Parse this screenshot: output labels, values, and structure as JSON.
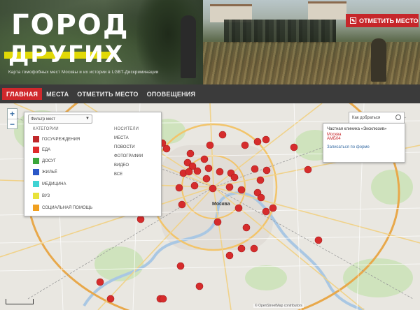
{
  "header": {
    "logo_line1": "ГОРОД",
    "logo_line2": "ДРУГИХ",
    "tagline": "Карта гомофобных мест Москвы и их истории в LGBT-Дискриминации",
    "report_button": "ОТМЕТИТЬ МЕСТО",
    "report_icon": "edit-icon"
  },
  "nav": {
    "items": [
      {
        "label": "ГЛАВНАЯ",
        "active": true
      },
      {
        "label": "МЕСТА",
        "active": false
      },
      {
        "label": "ОТМЕТИТЬ МЕСТО",
        "active": false
      },
      {
        "label": "ОПОВЕЩЕНИЯ",
        "active": false
      }
    ]
  },
  "map": {
    "zoom_in": "+",
    "zoom_out": "−",
    "city_label": "Москва",
    "copyright": "© OpenStreetMap contributors",
    "marker_color": "#d62c2c",
    "filter": {
      "select_value": "Фильтр мест",
      "categories_header": "КАТЕГОРИИ",
      "media_header": "НОСИТЕЛИ",
      "categories": [
        {
          "label": "ГОСУЧРЕЖДЕНИЯ",
          "color": "#c0282a"
        },
        {
          "label": "ЕДА",
          "color": "#e02b2b"
        },
        {
          "label": "ДОСУГ",
          "color": "#3aa63a"
        },
        {
          "label": "ЖИЛЬЁ",
          "color": "#2b57c7"
        },
        {
          "label": "МЕДИЦИНА",
          "color": "#3fd3d3"
        },
        {
          "label": "ВУЗ",
          "color": "#e8e23a"
        },
        {
          "label": "СОЦИАЛЬНАЯ ПОМОЩЬ",
          "color": "#f0a020"
        }
      ],
      "media": [
        "МЕСТА",
        "ПОВОСТИ",
        "ФОТОГРАФИИ",
        "ВИДЕО",
        "ВСЕ"
      ]
    },
    "search_placeholder": "Как добраться",
    "popup": {
      "line1": "Частная клиника «Эксклюзив»",
      "line2": "Москва",
      "line3": "АМБ04",
      "link": "Записаться по форме"
    }
  }
}
